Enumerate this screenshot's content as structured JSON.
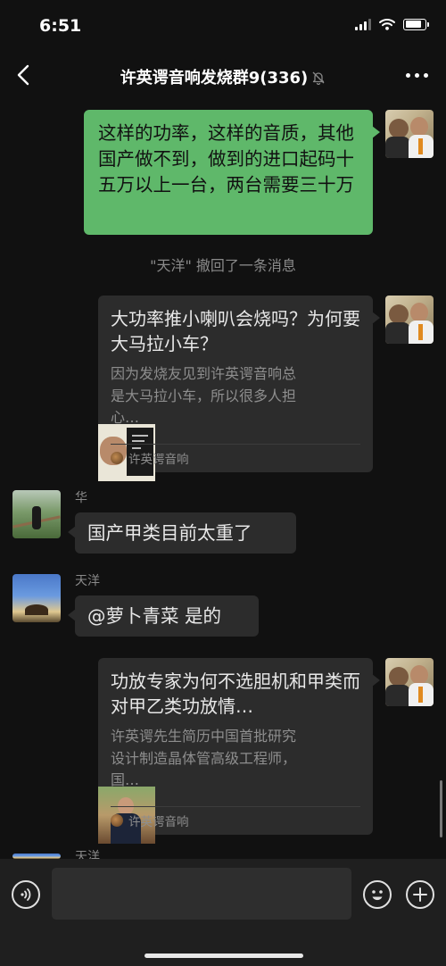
{
  "status_bar": {
    "time": "6:51"
  },
  "header": {
    "title": "许英谔音响发烧群",
    "count": "9(336)"
  },
  "messages": {
    "m1": {
      "text": "这样的功率，这样的音质，其他国产做不到，做到的进口起码十五万以上一台，两台需要三十万"
    },
    "recall": {
      "quote_name": "\"天洋\"",
      "text": " 撤回了一条消息"
    },
    "card1": {
      "title": "大功率推小喇叭会烧吗？为何要大马拉小车？",
      "desc": "因为发烧友见到许英谔音响总是大马拉小车，所以很多人担心…",
      "source": "许英谔音响"
    },
    "hua": {
      "sender": "华",
      "text": "国产甲类目前太重了"
    },
    "tianyang": {
      "sender": "天洋",
      "text": "@萝卜青菜 是的"
    },
    "card2": {
      "title": "功放专家为何不选胆机和甲类而对甲乙类功放情…",
      "desc": "许英谔先生简历中国首批研究设计制造晶体管高级工程师，国…",
      "source": "许英谔音响"
    },
    "partial_sender": "天洋"
  },
  "input": {
    "placeholder": ""
  },
  "icons": {
    "back": "chevron-left-icon",
    "mute": "bell-slash-icon",
    "more": "ellipsis-icon",
    "voice": "voice-icon",
    "emoji": "emoji-icon",
    "plus": "plus-icon"
  }
}
